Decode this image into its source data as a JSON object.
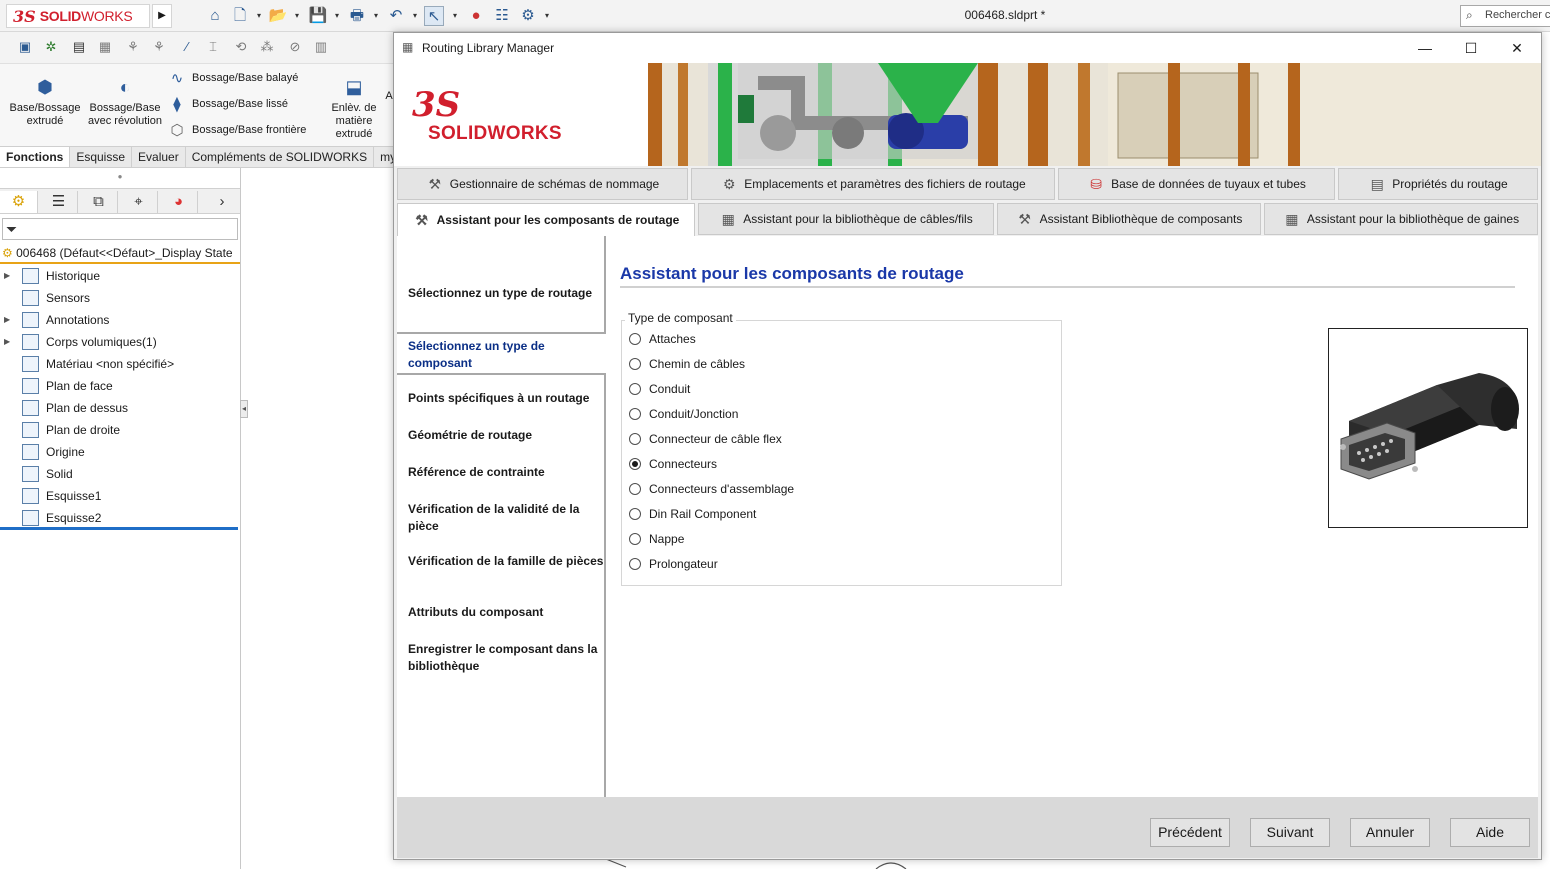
{
  "app": {
    "logo_ds": "3S",
    "logo_solid": "SOLID",
    "logo_works": "WORKS",
    "document_title": "006468.sldprt *",
    "search_placeholder": "Rechercher c"
  },
  "ribbon": {
    "extrude_boss": "Base/Bossage extrudé",
    "revolve_boss": "Bossage/Base avec révolution",
    "swept": "Bossage/Base balayé",
    "lofted": "Bossage/Base lissé",
    "boundary": "Bossage/Base frontière",
    "extruded_cut": "Enlèv. de matière extrudé",
    "extra": "A"
  },
  "command_tabs": [
    "Fonctions",
    "Esquisse",
    "Evaluer",
    "Compléments de SOLIDWORKS",
    "my"
  ],
  "feature_tree": {
    "root": "006468  (Défaut<<Défaut>_Display State",
    "items": [
      {
        "label": "Historique",
        "icon": "history-icon",
        "expand": "▶"
      },
      {
        "label": "Sensors",
        "icon": "sensors-icon",
        "expand": ""
      },
      {
        "label": "Annotations",
        "icon": "annotations-icon",
        "expand": "▶"
      },
      {
        "label": "Corps volumiques(1)",
        "icon": "solid-bodies-icon",
        "expand": "▶"
      },
      {
        "label": "Matériau <non spécifié>",
        "icon": "material-icon",
        "expand": ""
      },
      {
        "label": "Plan de face",
        "icon": "plane-icon",
        "expand": ""
      },
      {
        "label": "Plan de dessus",
        "icon": "plane-icon",
        "expand": ""
      },
      {
        "label": "Plan de droite",
        "icon": "plane-icon",
        "expand": ""
      },
      {
        "label": "Origine",
        "icon": "origin-icon",
        "expand": ""
      },
      {
        "label": "Solid",
        "icon": "solid-feature-icon",
        "expand": ""
      },
      {
        "label": "Esquisse1",
        "icon": "sketch-icon",
        "expand": ""
      },
      {
        "label": "Esquisse2",
        "icon": "sketch-icon",
        "expand": ""
      }
    ]
  },
  "dialog": {
    "title": "Routing Library Manager",
    "banner_ds": "3S",
    "banner_brand": "SOLIDWORKS",
    "tabs_row1": [
      "Gestionnaire de schémas de nommage",
      "Emplacements et paramètres des fichiers de routage",
      "Base de données de tuyaux et tubes",
      "Propriétés du routage"
    ],
    "tabs_row2": [
      "Assistant pour les composants de routage",
      "Assistant pour la bibliothèque de câbles/fils",
      "Assistant Bibliothèque de composants",
      "Assistant pour la bibliothèque de gaines"
    ],
    "steps": [
      "Sélectionnez un type de routage",
      "Sélectionnez un type de composant",
      "Points spécifiques à un routage",
      "Géométrie de routage",
      "Référence de contrainte",
      "Vérification de la validité de la pièce",
      "Vérification de la famille de pièces",
      "Attributs du composant",
      "Enregistrer le composant dans la bibliothèque"
    ],
    "selected_step": "Sélectionnez un type de composant",
    "heading": "Assistant pour les composants de routage",
    "group_label": "Type de composant",
    "component_types": [
      {
        "label": "Attaches",
        "checked": false
      },
      {
        "label": "Chemin de câbles",
        "checked": false
      },
      {
        "label": "Conduit",
        "checked": false
      },
      {
        "label": "Conduit/Jonction",
        "checked": false
      },
      {
        "label": "Connecteur de câble flex",
        "checked": false
      },
      {
        "label": "Connecteurs",
        "checked": true
      },
      {
        "label": "Connecteurs d'assemblage",
        "checked": false
      },
      {
        "label": "Din Rail Component",
        "checked": false
      },
      {
        "label": "Nappe",
        "checked": false
      },
      {
        "label": "Prolongateur",
        "checked": false
      }
    ],
    "buttons": {
      "previous": "Précédent",
      "next": "Suivant",
      "cancel": "Annuler",
      "help": "Aide"
    }
  },
  "colors": {
    "brand_red": "#d11f2d",
    "heading_blue": "#1a38a8",
    "selected_step_blue": "#0b2f86",
    "tree_root_underline": "#e8a317",
    "rollback_bar": "#1f6ec7"
  }
}
